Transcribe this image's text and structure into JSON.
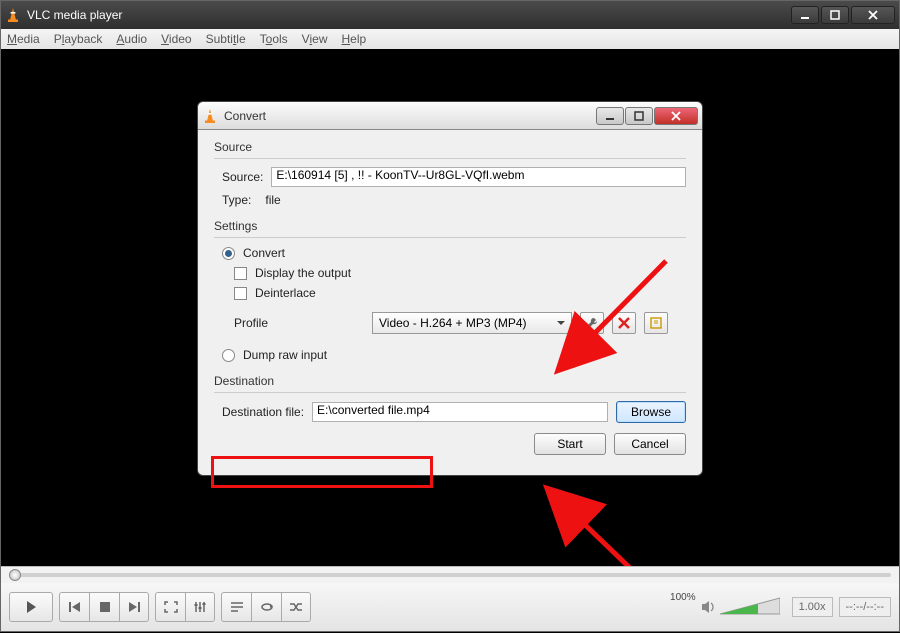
{
  "main": {
    "title": "VLC media player",
    "menu": [
      "Media",
      "Playback",
      "Audio",
      "Video",
      "Subtitle",
      "Tools",
      "View",
      "Help"
    ]
  },
  "dialog": {
    "title": "Convert",
    "source_group": "Source",
    "source_label": "Source:",
    "source_value": "E:\\160914 [5]   , !! - KoonTV--Ur8GL-VQfI.webm",
    "type_label": "Type:",
    "type_value": "file",
    "settings_group": "Settings",
    "convert_label": "Convert",
    "display_output_label": "Display the output",
    "deinterlace_label": "Deinterlace",
    "profile_label": "Profile",
    "profile_value": "Video - H.264 + MP3 (MP4)",
    "dump_label": "Dump raw input",
    "destination_group": "Destination",
    "destination_label": "Destination file:",
    "destination_value": "E:\\converted file.mp4",
    "browse_label": "Browse",
    "start_label": "Start",
    "cancel_label": "Cancel"
  },
  "controls": {
    "speed": "1.00x",
    "time": "--:--/--:--",
    "volume_pct": "100%"
  }
}
